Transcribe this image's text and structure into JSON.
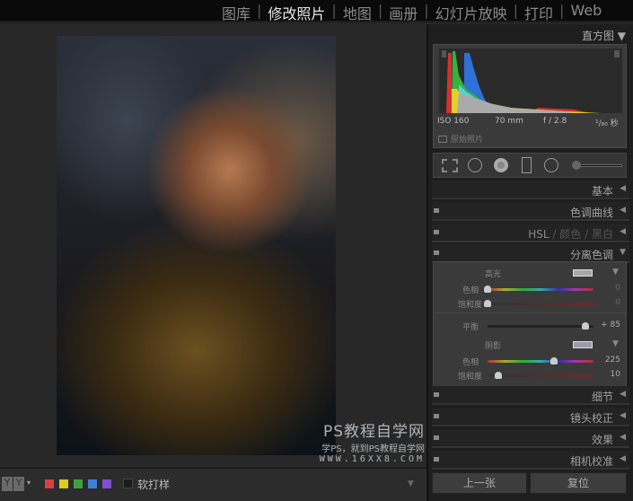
{
  "modules": [
    {
      "label": "图库",
      "active": false
    },
    {
      "label": "修改照片",
      "active": true
    },
    {
      "label": "地图",
      "active": false
    },
    {
      "label": "画册",
      "active": false
    },
    {
      "label": "幻灯片放映",
      "active": false
    },
    {
      "label": "打印",
      "active": false
    },
    {
      "label": "Web",
      "active": false
    }
  ],
  "histogram": {
    "title": "直方图",
    "iso": "ISO 160",
    "focal": "70 mm",
    "aperture": "f / 2.8",
    "shutter": "¹/₈₀ 秒",
    "original_label": "原始照片"
  },
  "panels": {
    "basic": "基本",
    "tone_curve": "色调曲线",
    "hsl": "HSL",
    "color": "颜色",
    "bw": "黑白",
    "split_toning": "分离色调",
    "detail": "细节",
    "lens": "镜头校正",
    "effects": "效果",
    "camera": "相机校准"
  },
  "split_toning": {
    "highlights": "高光",
    "hue_label": "色相",
    "sat_label": "饱和度",
    "balance_label": "平衡",
    "shadows": "阴影",
    "highlight_hue": "0",
    "highlight_sat": "0",
    "balance": "+ 85",
    "shadow_hue": "225",
    "shadow_sat": "10",
    "highlight_hue_pct": 0,
    "highlight_sat_pct": 0,
    "balance_pct": 92.5,
    "shadow_hue_pct": 62.5,
    "shadow_sat_pct": 10
  },
  "bottom": {
    "yy": "Y",
    "softproof": "软打样",
    "colors": [
      "#d8403f",
      "#d8d020",
      "#40a040",
      "#3f80d8",
      "#8050d0"
    ]
  },
  "buttons": {
    "previous": "上一张",
    "reset": "复位"
  },
  "watermark": {
    "line1": "PS教程自学网",
    "line2": "学PS，就到PS教程自学网",
    "line3": "WWW.16XX8.COM"
  }
}
